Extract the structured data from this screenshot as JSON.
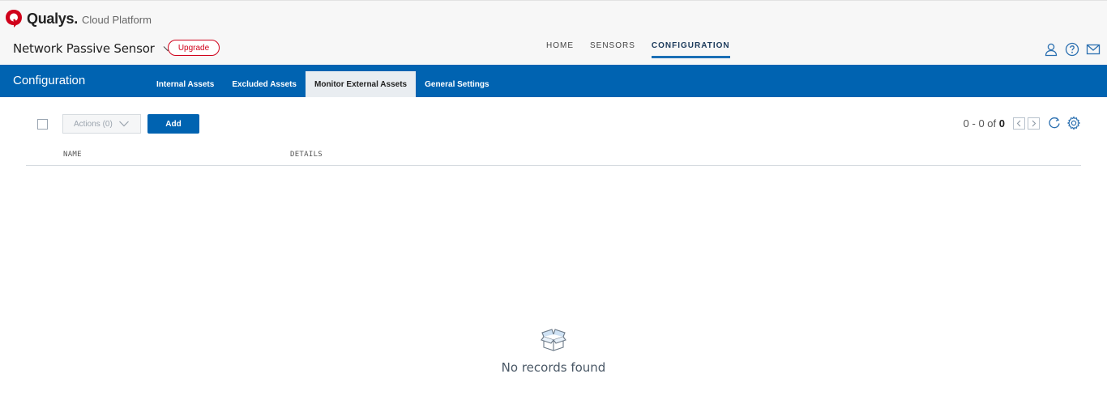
{
  "brand": {
    "name": "Qualys",
    "dot": ".",
    "platform": "Cloud Platform"
  },
  "product": {
    "name": "Network Passive Sensor",
    "upgrade_label": "Upgrade"
  },
  "top_nav": [
    {
      "label": "HOME",
      "active": false
    },
    {
      "label": "SENSORS",
      "active": false
    },
    {
      "label": "CONFIGURATION",
      "active": true
    }
  ],
  "top_icons": [
    "user-icon",
    "help-icon",
    "mail-icon"
  ],
  "section": {
    "title": "Configuration",
    "tabs": [
      {
        "label": "Internal Assets",
        "active": false
      },
      {
        "label": "Excluded Assets",
        "active": false
      },
      {
        "label": "Monitor External Assets",
        "active": true
      },
      {
        "label": "General Settings",
        "active": false
      }
    ]
  },
  "toolbar": {
    "actions_label": "Actions (0)",
    "add_label": "Add"
  },
  "pager": {
    "range": "0 - 0 of",
    "total": "0"
  },
  "table": {
    "columns": [
      "NAME",
      "DETAILS"
    ],
    "rows": []
  },
  "empty_state": {
    "message": "No records found",
    "icon": "empty-box-icon"
  },
  "colors": {
    "primary": "#0063b1",
    "brand_red": "#d0021b",
    "active_tab_bg": "#e9edf1"
  }
}
